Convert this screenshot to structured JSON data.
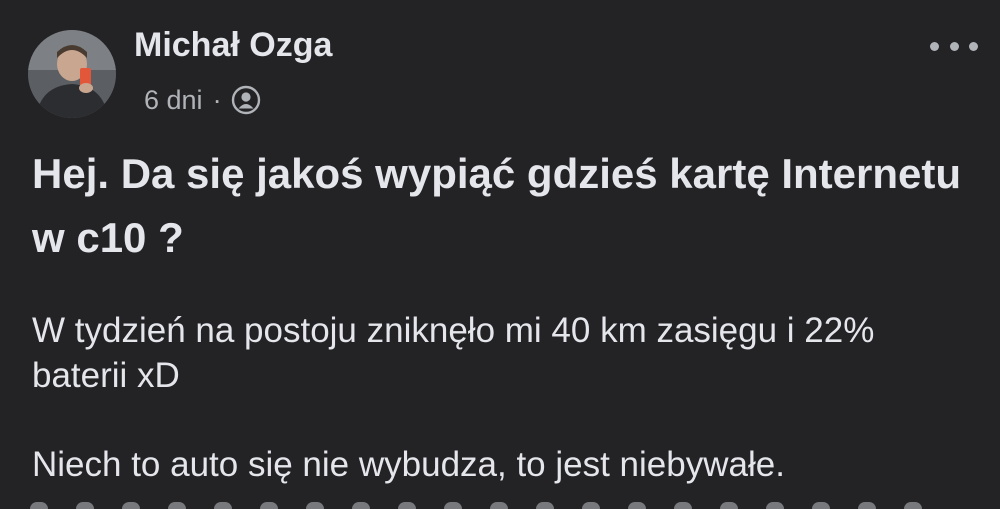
{
  "post": {
    "author": "Michał Ozga",
    "time": "6 dni",
    "separator": "·",
    "audience_icon": "friends-icon",
    "more_icon": "more-horizontal-icon",
    "title": "Hej. Da się jakoś wypiąć gdzieś kartę Internetu w c10 ?",
    "body_paragraph_1": "W tydzień na postoju zniknęło mi 40 km zasięgu i 22% baterii xD",
    "body_paragraph_2": "Niech to auto się nie wybudza, to jest niebywałe."
  },
  "colors": {
    "background": "#232325",
    "primary_text": "#e4e6eb",
    "secondary_text": "#b0b3b8"
  }
}
